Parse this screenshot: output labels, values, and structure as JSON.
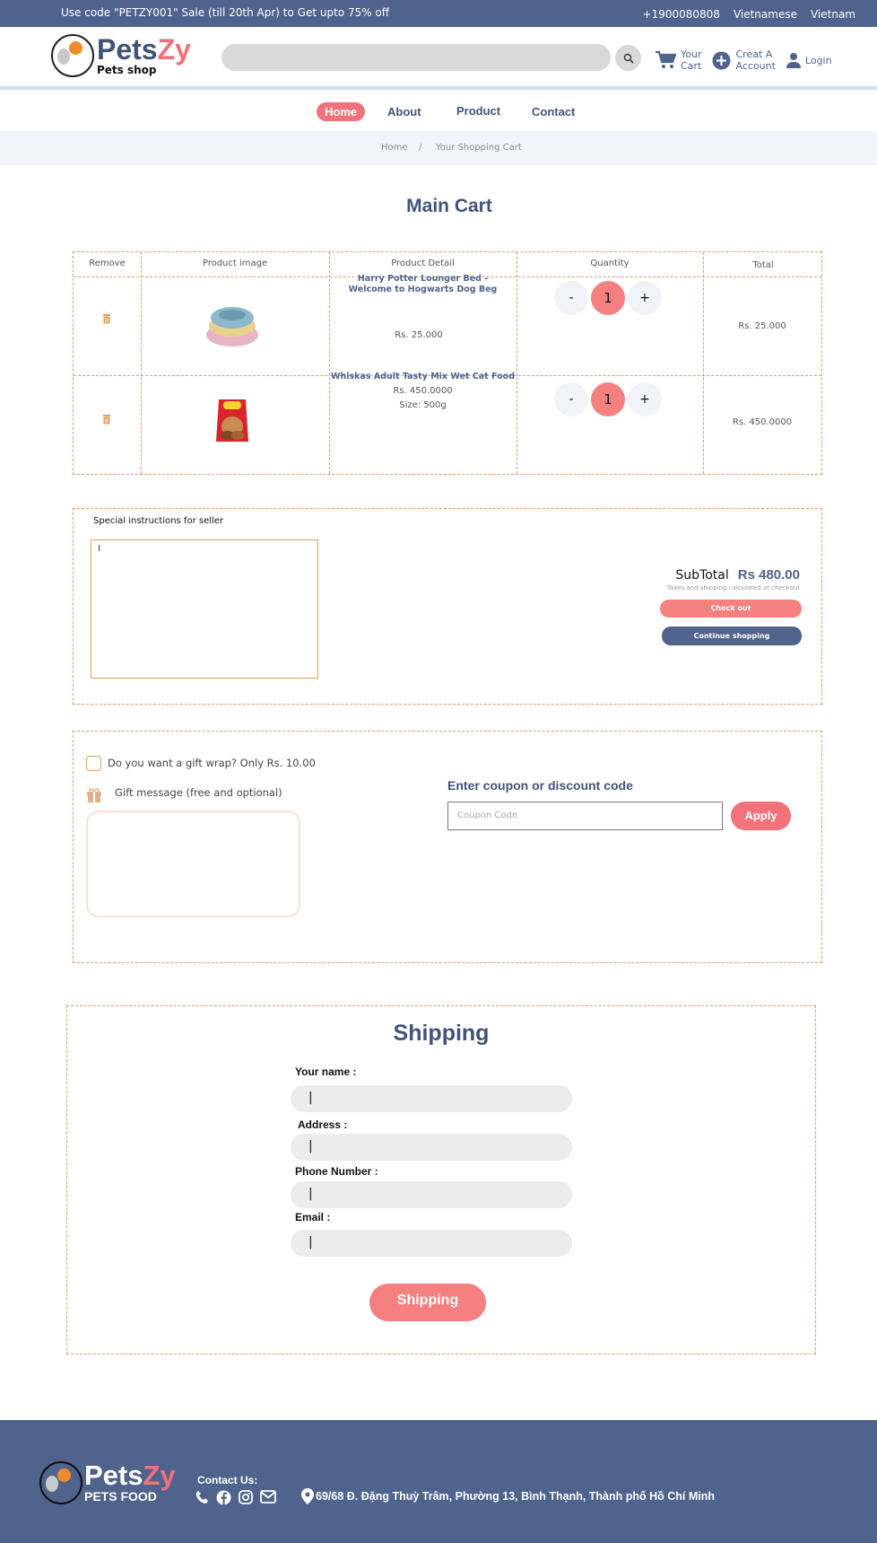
{
  "topbar": {
    "promo": "Use code \"PETZY001\" Sale (till 20th Apr) to Get upto 75% off",
    "phone": "+1900080808",
    "language": "Vietnamese",
    "country": "Vietnam"
  },
  "header": {
    "brand_a": "Pets",
    "brand_b": "Zy",
    "brand_sub": "Pets shop",
    "search_placeholder": "",
    "cart_label_1": "Your",
    "cart_label_2": "Cart",
    "account_label_1": "Creat A",
    "account_label_2": "Account",
    "login_label": "Login"
  },
  "nav": {
    "items": [
      "Home",
      "About",
      "Product",
      "Contact"
    ],
    "active": "Home"
  },
  "breadcrumb": {
    "home": "Home",
    "sep": "/",
    "current": "Your Shopping Cart"
  },
  "cart": {
    "title": "Main Cart",
    "headers": [
      "Remove",
      "Product image",
      "Product Detail",
      "Quantity",
      "Total"
    ],
    "items": [
      {
        "name_1": "Harry Potter Lounger Bed -",
        "name_2": "Welcome to Hogwarts Dog Beg",
        "price": "Rs. 25.000",
        "size": "",
        "qty": "1",
        "total": "Rs. 25.000"
      },
      {
        "name_1": "Whiskas Adult  Tasty Mix Wet Cat Food",
        "name_2": "",
        "price": "Rs. 450.0000",
        "size": "Size: 500g",
        "qty": "1",
        "total": "Rs. 450.0000"
      }
    ],
    "minus": "-",
    "plus": "+"
  },
  "instructions": {
    "label": "Special instructions for seller",
    "value": "I",
    "subtotal_label": "SubTotal",
    "subtotal_value": "Rs 480.00",
    "tax_note": "Taxes and shipping calculated at checkout",
    "checkout": "Check out",
    "continue": "Continue shopping"
  },
  "gift": {
    "question": "Do you want a gift wrap? Only Rs. 10.00",
    "message_label": "Gift message (free and optional)",
    "coupon_title": "Enter coupon or discount code",
    "coupon_placeholder": "Coupon Code",
    "apply": "Apply"
  },
  "shipping": {
    "title": "Shipping",
    "name_label": "Your name :",
    "address_label": "Address  :",
    "phone_label": "Phone Number   :",
    "email_label": "Email :",
    "cursor": "|",
    "button": "Shipping"
  },
  "footer": {
    "brand_a": "Pets",
    "brand_b": "Zy",
    "brand_sub": "PETS FOOD",
    "contact": "Contact Us:",
    "address": "69/68 Đ. Đặng Thuỳ Trâm, Phường 13, Bình Thạnh, Thành phố Hồ Chí Minh"
  },
  "colors": {
    "primary": "#4f638c",
    "accent": "#f1727a",
    "dashed": "#e09a66"
  }
}
